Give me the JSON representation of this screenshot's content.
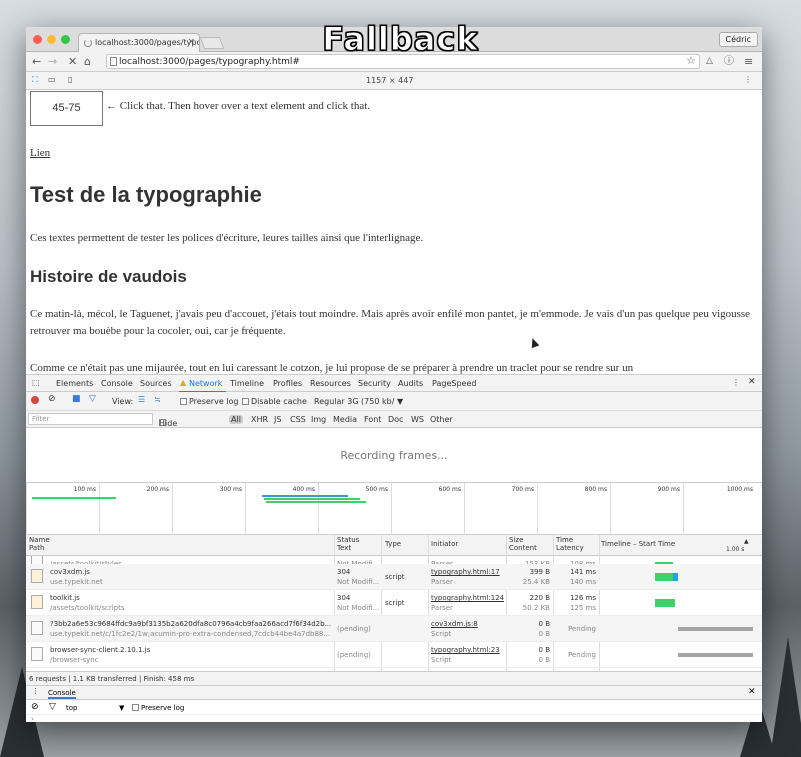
{
  "overlay": {
    "title": "Fallback"
  },
  "browser": {
    "tab_title": "localhost:3000/pages/typo",
    "user_label": "Cédric",
    "url": "localhost:3000/pages/typography.html#",
    "device_dims": "1157 × 447"
  },
  "page": {
    "toggle_button": "45-75",
    "hint": "← Click that. Then hover over a text element and click that.",
    "link": "Lien",
    "h1": "Test de la typographie",
    "intro": "Ces textes permettent de tester les polices d'écriture, leures tailles ainsi que l'interlignage.",
    "h2": "Histoire de vaudois",
    "para1": "Ce matin-là, mécol, le Taguenet, j'avais peu d'accouet, j'étais tout moindre. Mais après avoir enfilé mon pantet, je m'emmode. Je vais d'un pas quelque peu vigousse retrouver ma bouèbe pour la cocoler, oui, car je fréquente.",
    "para2": "Comme ce n'était pas une mijaurée, tout en lui caressant le cotzon, je lui propose de se préparer à prendre un traclet pour se rendre sur un"
  },
  "devtools": {
    "tabs": [
      "Elements",
      "Console",
      "Sources",
      "Network",
      "Timeline",
      "Profiles",
      "Resources",
      "Security",
      "Audits",
      "PageSpeed"
    ],
    "active_tab": "Network",
    "network_toolbar": {
      "view_label": "View:",
      "preserve_log": "Preserve log",
      "disable_cache": "Disable cache",
      "throttle": "Regular 3G (750 kb/"
    },
    "filter": {
      "placeholder": "Filter",
      "hide_data_urls": "Hide data URLs",
      "types": [
        "All",
        "XHR",
        "JS",
        "CSS",
        "Img",
        "Media",
        "Font",
        "Doc",
        "WS",
        "Other"
      ]
    },
    "recording": "Recording frames...",
    "overview_ticks": [
      "100 ms",
      "200 ms",
      "300 ms",
      "400 ms",
      "500 ms",
      "600 ms",
      "700 ms",
      "800 ms",
      "900 ms",
      "1000 ms"
    ],
    "columns": {
      "name": "Name",
      "path": "Path",
      "status": "Status",
      "text": "Text",
      "type": "Type",
      "initiator": "Initiator",
      "size": "Size",
      "content": "Content",
      "time": "Time",
      "latency": "Latency",
      "timeline": "Timeline – Start Time",
      "timeline_mark": "1.00 s"
    },
    "rows": [
      {
        "name": "",
        "path": "/assets/toolkit/styles",
        "status": "",
        "text": "Not Modifi...",
        "type": "",
        "initiator": "",
        "initiator2": "Parser",
        "size": "",
        "content": "153 KB",
        "time": "",
        "latency": "108 ms",
        "icon": "css"
      },
      {
        "name": "cov3xdm.js",
        "path": "use.typekit.net",
        "status": "304",
        "text": "Not Modifi...",
        "type": "script",
        "initiator": "typography.html:17",
        "initiator2": "Parser",
        "size": "399 B",
        "content": "25.4 KB",
        "time": "141 ms",
        "latency": "140 ms",
        "icon": "js"
      },
      {
        "name": "toolkit.js",
        "path": "/assets/toolkit/scripts",
        "status": "304",
        "text": "Not Modifi...",
        "type": "script",
        "initiator": "typography.html:124",
        "initiator2": "Parser",
        "size": "220 B",
        "content": "50.2 KB",
        "time": "126 ms",
        "latency": "125 ms",
        "icon": "js"
      },
      {
        "name": "?3bb2a6e53c9684ffdc9a9bf3135b2a620dfa8c0796a4cb9faa266acd7f6f34d2b...",
        "path": "use.typekit.net/c/1fc2e2/1w;acumin-pro-extra-condensed,7cdcb44be4a7db88...",
        "status": "(pending)",
        "text": "",
        "type": "",
        "initiator": "cov3xdm.js:8",
        "initiator2": "Script",
        "size": "0 B",
        "content": "0 B",
        "time": "Pending",
        "latency": "",
        "icon": "doc"
      },
      {
        "name": "browser-sync-client.2.10.1.js",
        "path": "/browser-sync",
        "status": "(pending)",
        "text": "",
        "type": "",
        "initiator": "typography.html:23",
        "initiator2": "Script",
        "size": "0 B",
        "content": "0 B",
        "time": "Pending",
        "latency": "",
        "icon": "doc"
      }
    ],
    "summary": "6 requests  |  1.1 KB transferred  |  Finish: 458 ms",
    "console": {
      "tab": "Console",
      "context": "top",
      "preserve_log": "Preserve log"
    }
  }
}
